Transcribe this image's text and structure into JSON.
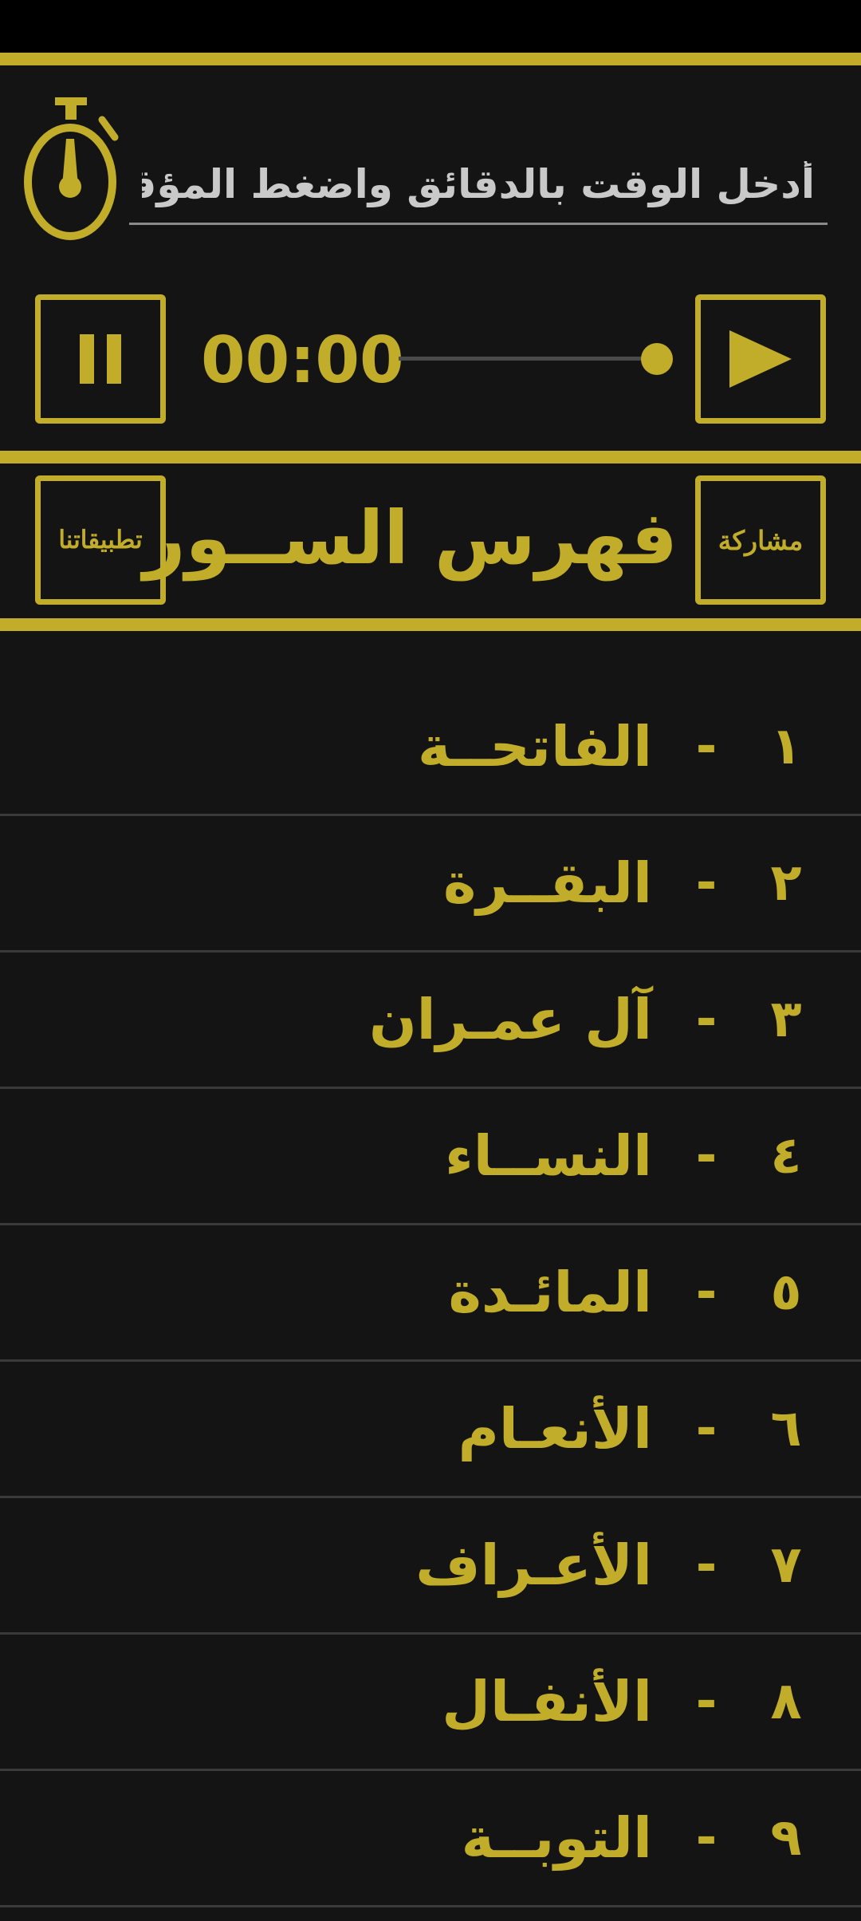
{
  "timer": {
    "placeholder": "أدخل الوقت بالدقائق واضغط المؤقت",
    "time_display": "00:00",
    "seek_progress": 1.0
  },
  "header": {
    "share_label": "مشاركة",
    "title": "فهرس الســور",
    "apps_label": "تطبيقاتنا"
  },
  "surahs": [
    {
      "num": "١",
      "name": "الفاتحــة"
    },
    {
      "num": "٢",
      "name": "البقــرة"
    },
    {
      "num": "٣",
      "name": "آل عمـران"
    },
    {
      "num": "٤",
      "name": "النســاء"
    },
    {
      "num": "٥",
      "name": "المائـدة"
    },
    {
      "num": "٦",
      "name": "الأنعـام"
    },
    {
      "num": "٧",
      "name": "الأعـراف"
    },
    {
      "num": "٨",
      "name": "الأنفـال"
    },
    {
      "num": "٩",
      "name": "التوبــة"
    }
  ],
  "separator": "-",
  "colors": {
    "accent": "#c2ad2b",
    "background": "#141414",
    "status_bar": "#000000",
    "row_divider": "#3a3a3a"
  }
}
